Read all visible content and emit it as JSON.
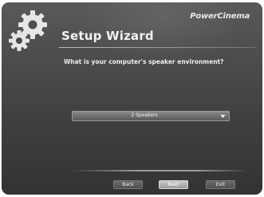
{
  "header": {
    "brand": "PowerCinema",
    "title": "Setup Wizard",
    "logo_icon": "gears-icon"
  },
  "main": {
    "question": "What is your computer's speaker environment?",
    "speaker_select": {
      "value": "2 Speakers",
      "arrow_icon": "chevron-down-icon"
    }
  },
  "footer": {
    "back_label": "Back",
    "next_label": "Next",
    "exit_label": "Exit"
  }
}
